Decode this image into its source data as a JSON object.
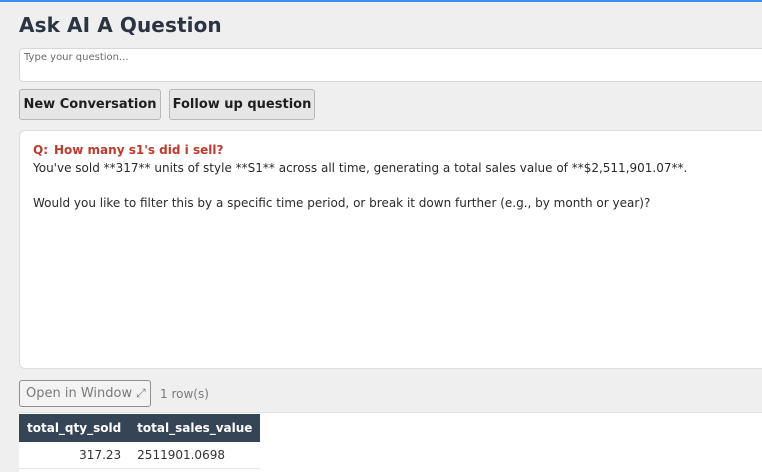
{
  "header": {
    "title": "Ask AI A Question"
  },
  "question_input": {
    "placeholder": "Type your question..."
  },
  "buttons": {
    "new_conversation": "New Conversation",
    "follow_up": "Follow up question"
  },
  "answer": {
    "question_prefix": "Q:",
    "question_text": "How many s1's did i sell?",
    "response_line1": "You've sold **317** units of style **S1** across all time, generating a total sales value of **$2,511,901.07**.",
    "response_line2": "Would you like to filter this by a specific time period, or break it down further (e.g., by month or year)?"
  },
  "results": {
    "open_window_label": "Open in Window",
    "expand_icon": "expand-icon",
    "row_count": "1 row(s)",
    "columns": [
      "total_qty_sold",
      "total_sales_value"
    ],
    "rows": [
      [
        "317.23",
        "2511901.0698"
      ]
    ]
  },
  "colors": {
    "accent_line": "#3b8ef0",
    "question_red": "#c0392b",
    "table_header_bg": "#364556"
  }
}
